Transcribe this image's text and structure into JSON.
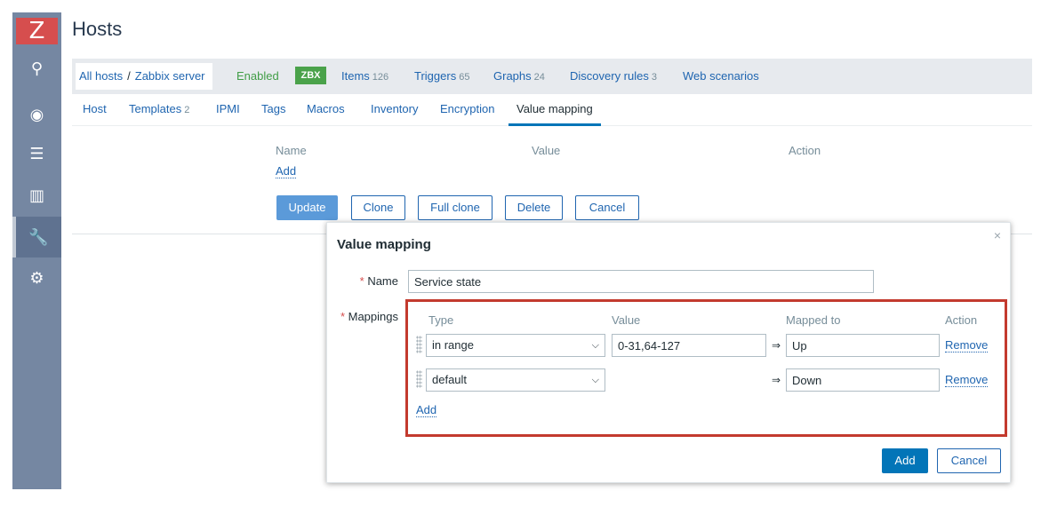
{
  "sidebar": {
    "logo": "Z",
    "items": [
      {
        "icon": "search-icon",
        "glyph": "⚲"
      },
      {
        "icon": "eye-icon",
        "glyph": "◉"
      },
      {
        "icon": "list-icon",
        "glyph": "☰"
      },
      {
        "icon": "reports-icon",
        "glyph": "▥"
      },
      {
        "icon": "wrench-icon",
        "glyph": "🔧"
      },
      {
        "icon": "gear-icon",
        "glyph": "⚙"
      }
    ]
  },
  "page": {
    "title": "Hosts"
  },
  "breadcrumb": {
    "all_hosts": "All hosts",
    "separator": "/",
    "host": "Zabbix server",
    "status": "Enabled",
    "badge": "ZBX",
    "items_label": "Items",
    "items_count": "126",
    "triggers_label": "Triggers",
    "triggers_count": "65",
    "graphs_label": "Graphs",
    "graphs_count": "24",
    "discovery_label": "Discovery rules",
    "discovery_count": "3",
    "web_label": "Web scenarios"
  },
  "tabs": {
    "host": "Host",
    "templates": "Templates",
    "templates_count": "2",
    "ipmi": "IPMI",
    "tags": "Tags",
    "macros": "Macros",
    "inventory": "Inventory",
    "encryption": "Encryption",
    "value_mapping": "Value mapping"
  },
  "value_mapping_table": {
    "col_name": "Name",
    "col_value": "Value",
    "col_action": "Action",
    "add_link": "Add"
  },
  "form_buttons": {
    "update": "Update",
    "clone": "Clone",
    "full_clone": "Full clone",
    "delete": "Delete",
    "cancel": "Cancel"
  },
  "modal": {
    "title": "Value mapping",
    "close": "×",
    "name_label": "Name",
    "name_value": "Service state",
    "mappings_label": "Mappings",
    "required_mark": "*",
    "headers": {
      "type": "Type",
      "value": "Value",
      "mapped_to": "Mapped to",
      "action": "Action"
    },
    "rows": [
      {
        "type": "in range",
        "value": "0-31,64-127",
        "arrow": "⇒",
        "mapped_to": "Up",
        "remove": "Remove"
      },
      {
        "type": "default",
        "value": "",
        "arrow": "⇒",
        "mapped_to": "Down",
        "remove": "Remove"
      }
    ],
    "add_link": "Add",
    "add_button": "Add",
    "cancel_button": "Cancel"
  },
  "colors": {
    "accent": "#0275b8",
    "link": "#1f65b0",
    "sidebar": "#7587a2",
    "logo": "#d64e4e",
    "highlight_border": "#c33a2e",
    "enabled": "#429e47"
  }
}
